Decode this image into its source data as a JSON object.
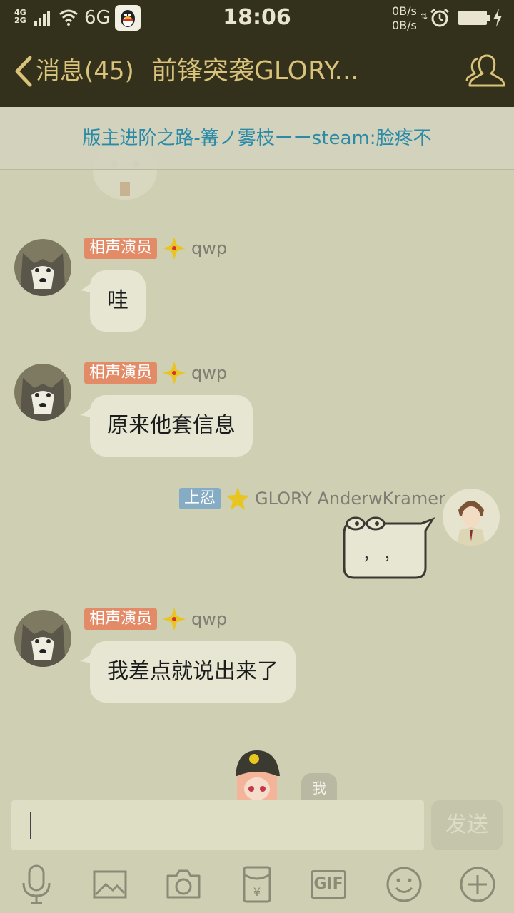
{
  "status_bar": {
    "network_top": "4G",
    "network_bottom": "2G",
    "network": "6G",
    "time": "18:06",
    "upload_speed": "0B/s",
    "download_speed": "0B/s"
  },
  "header": {
    "back_label": "消息(45)",
    "title": "前锋突袭GLORY..."
  },
  "announcement": {
    "text": "版主进阶之路-篝ノ雾枝ーーsteam:脸疼不"
  },
  "messages": [
    {
      "badge": "相声演员",
      "name": "qwp",
      "text": "哇"
    },
    {
      "badge": "相声演员",
      "name": "qwp",
      "text": "原来他套信息"
    },
    {
      "badge": "上忍",
      "name": "GLORY AnderwKramer",
      "sticker_text": "，  ，"
    },
    {
      "badge": "相声演员",
      "name": "qwp",
      "text": "我差点就说出来了"
    }
  ],
  "partial_message": {
    "text": "我"
  },
  "input": {
    "value": "",
    "send_label": "发送"
  },
  "toolbar": {
    "gif_label": "GIF",
    "icons": [
      "microphone-icon",
      "image-icon",
      "camera-icon",
      "red-packet-icon",
      "gif-icon",
      "emoji-icon",
      "plus-icon"
    ]
  },
  "colors": {
    "bar_bg": "#33301b",
    "accent_gold": "#d9c27a",
    "chat_bg": "#cfcfb4",
    "bubble_bg": "#e6e6d3",
    "badge_orange": "#e38a66",
    "badge_blue": "#86abc4",
    "announcement_text": "#2a8aa8"
  }
}
